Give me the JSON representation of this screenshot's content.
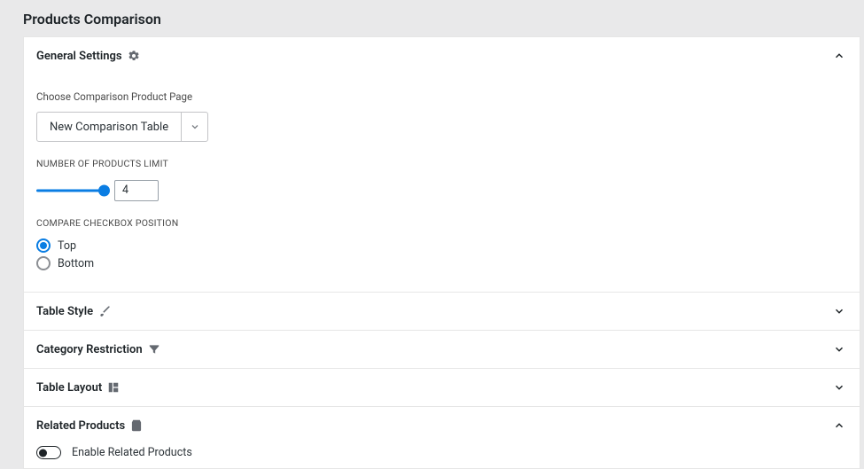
{
  "page": {
    "title": "Products Comparison"
  },
  "sections": {
    "general": {
      "title": "General Settings"
    },
    "tableStyle": {
      "title": "Table Style"
    },
    "catRestrict": {
      "title": "Category Restriction"
    },
    "tableLayout": {
      "title": "Table Layout"
    },
    "related": {
      "title": "Related Products"
    }
  },
  "general": {
    "choosePageLabel": "Choose Comparison Product Page",
    "choosePageValue": "New Comparison Table",
    "limitLabel": "Number of Products Limit",
    "limitValue": "4",
    "checkboxPositionLabel": "Compare Checkbox Position",
    "positionTop": "Top",
    "positionBottom": "Bottom"
  },
  "related": {
    "enableLabel": "Enable Related Products"
  }
}
